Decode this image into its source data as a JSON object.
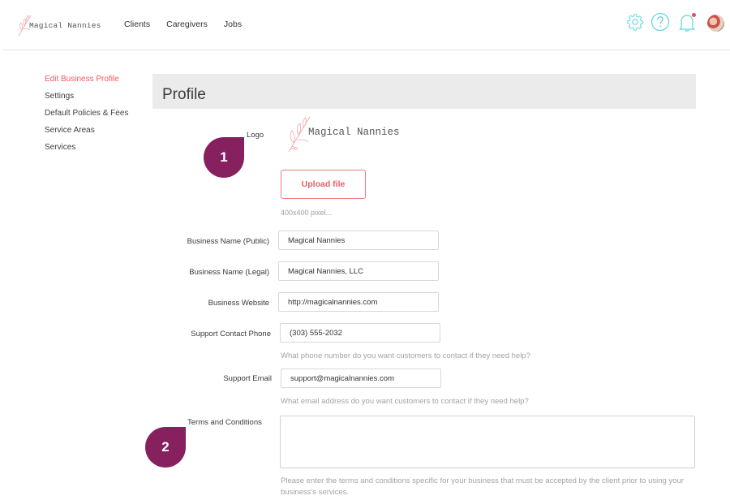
{
  "brand": {
    "name": "Magical Nannies"
  },
  "nav": {
    "items": [
      "Clients",
      "Caregivers",
      "Jobs"
    ]
  },
  "header_icons": {
    "settings": "gear-icon",
    "help": "help-circle-icon",
    "notifications": "bell-icon",
    "has_notification": true,
    "avatar": "user-avatar"
  },
  "colors": {
    "accent": "#ef5a60",
    "icon": "#5fd6dc",
    "badge": "#86205f",
    "header_bg": "#ebebeb"
  },
  "sidebar": {
    "items": [
      {
        "label": "Edit Business Profile",
        "active": true
      },
      {
        "label": "Settings"
      },
      {
        "label": "Default Policies & Fees"
      },
      {
        "label": "Service Areas"
      },
      {
        "label": "Services"
      }
    ]
  },
  "profile": {
    "title": "Profile",
    "logo_label": "Logo",
    "logo_text": "Magical Nannies",
    "upload_label": "Upload file",
    "upload_hint": "400x400 pixel...",
    "fields": [
      {
        "label": "Business Name (Public)",
        "value": "Magical Nannies"
      },
      {
        "label": "Business Name (Legal)",
        "value": "Magical Nannies, LLC"
      },
      {
        "label": "Business Website",
        "value": "http://magicalnannies.com"
      },
      {
        "label": "Support Contact Phone",
        "value": "(303) 555-2032",
        "hint": "What phone number do you want customers to contact if they need help?"
      },
      {
        "label": "Support Email",
        "value": "support@magicalnannies.com",
        "hint": "What email address do you want customers to contact if they need help?"
      }
    ],
    "terms": {
      "label": "Terms and Conditions",
      "value": "",
      "hint": "Please enter the terms and conditions specific for your business that must be accepted by the client prior to using your business's services."
    }
  },
  "badges": [
    "1",
    "2"
  ]
}
